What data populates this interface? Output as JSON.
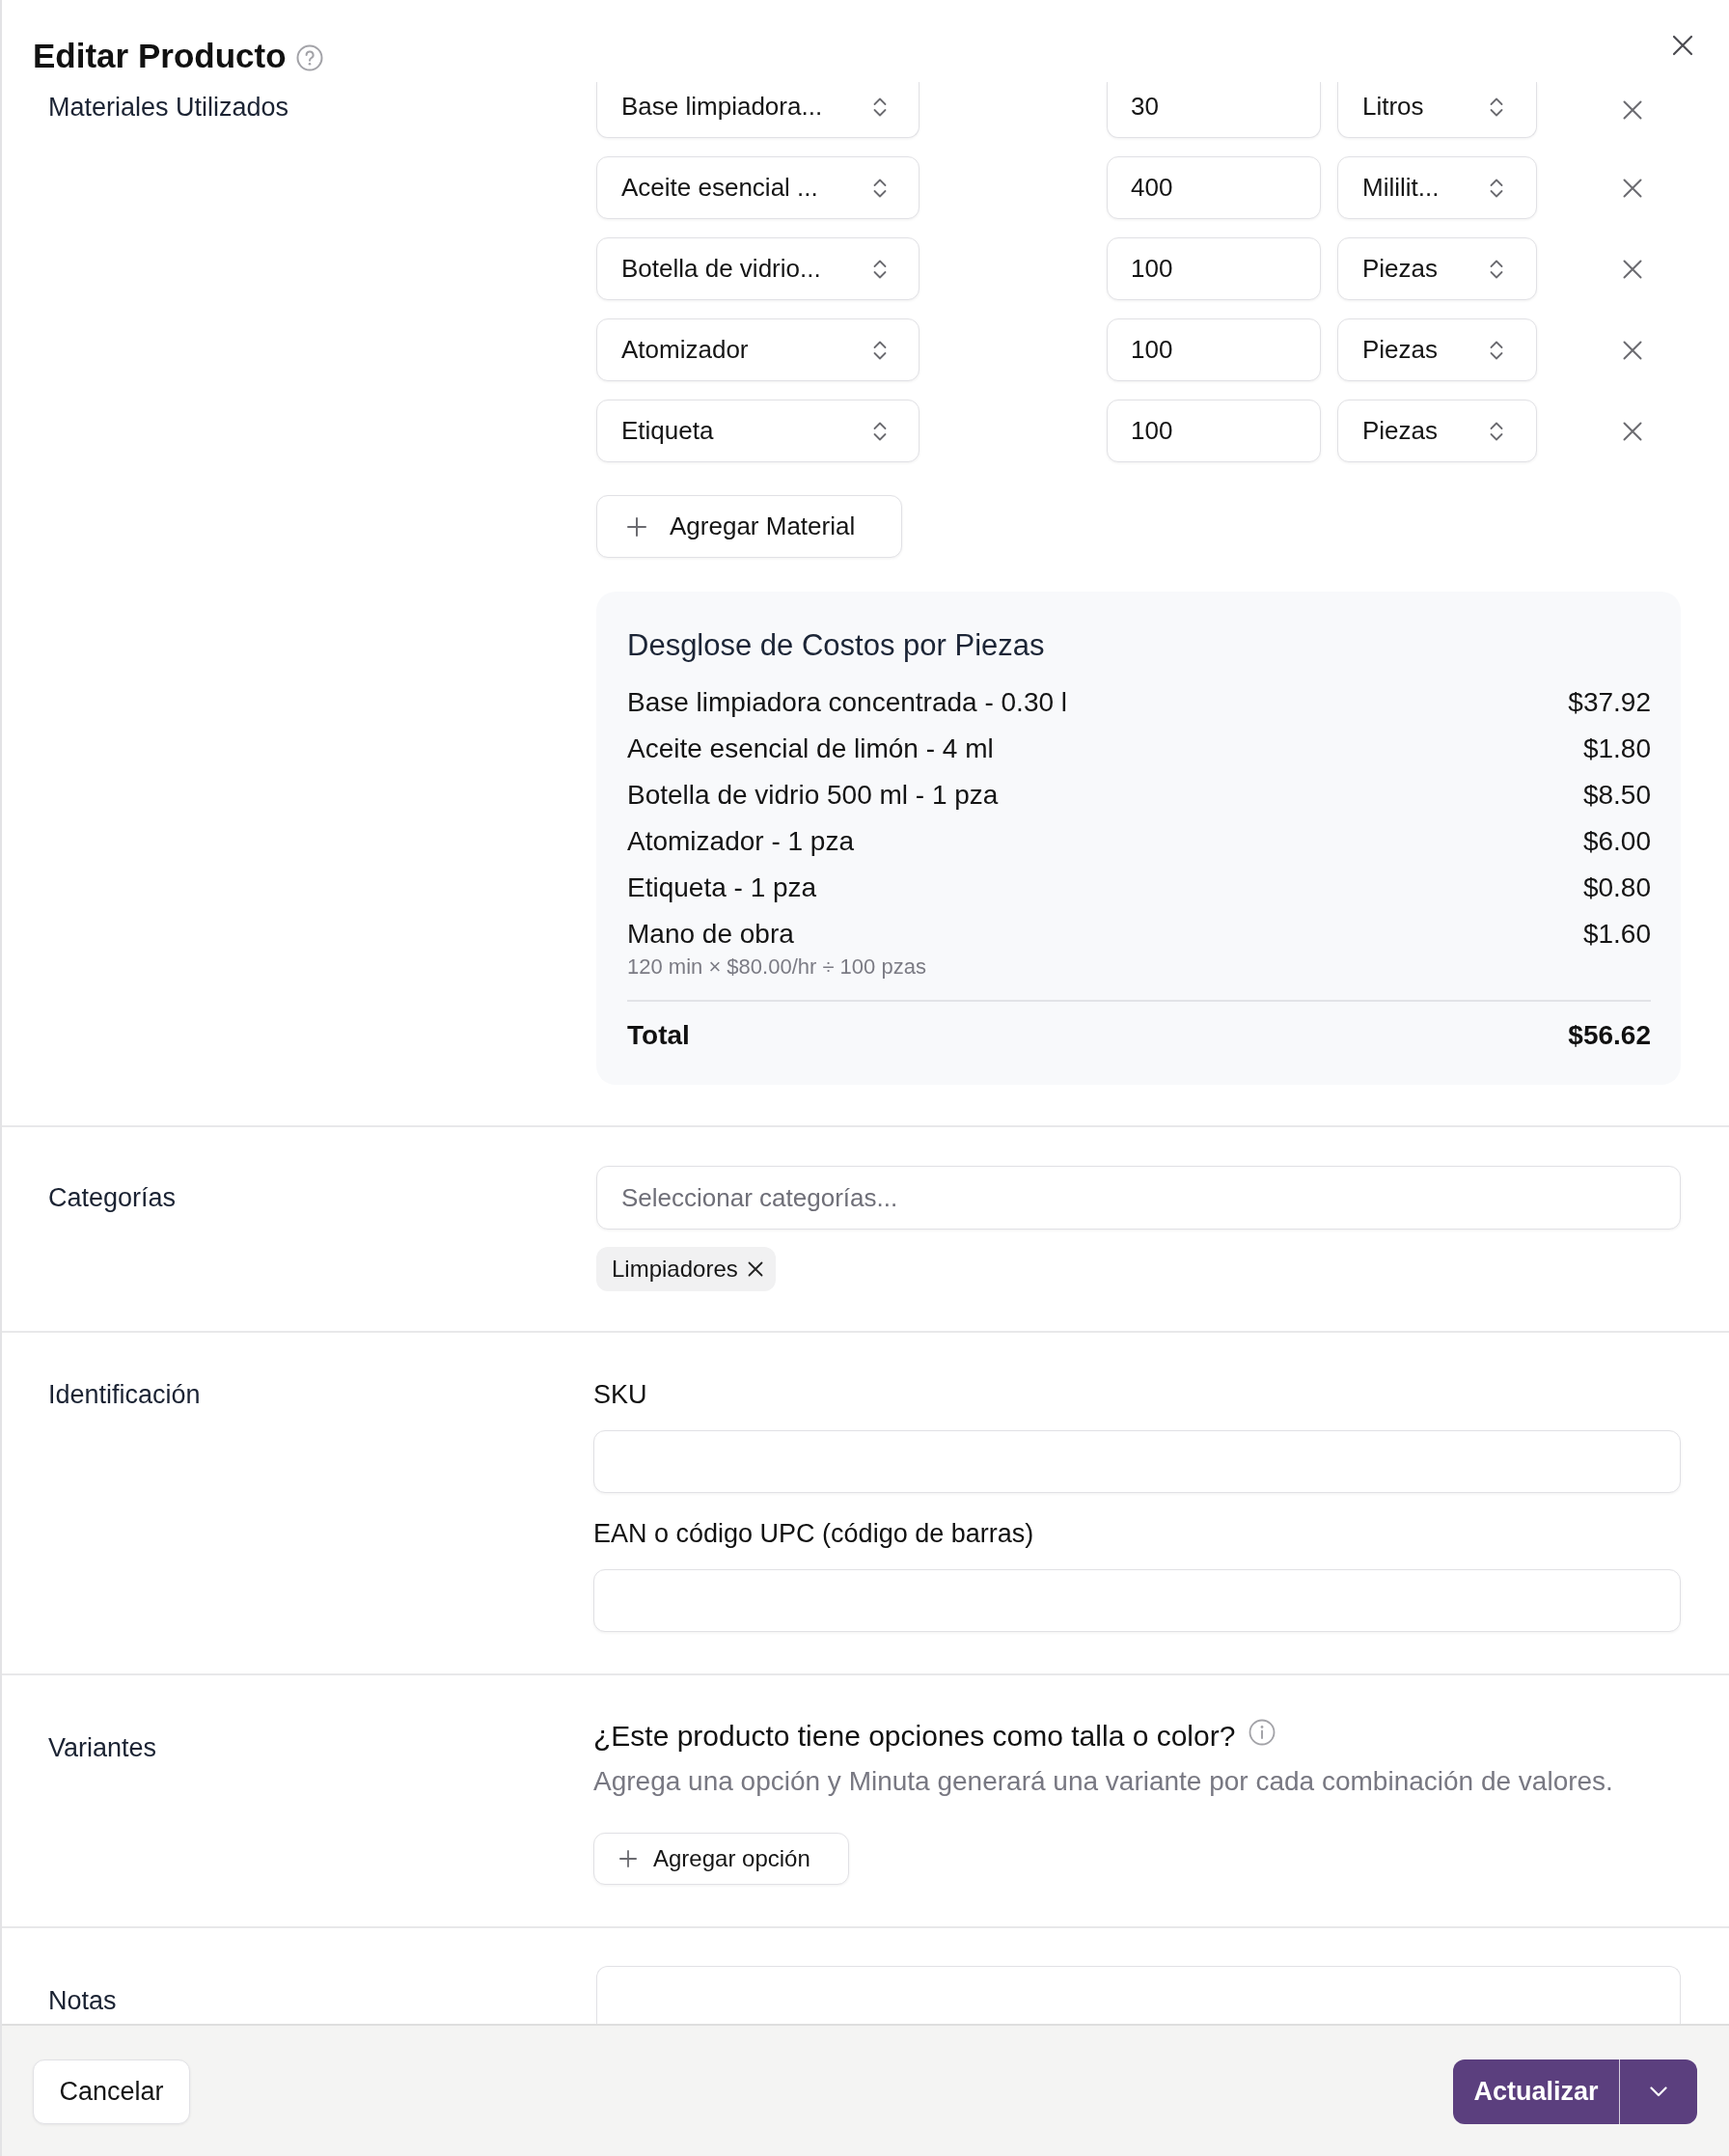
{
  "dialog": {
    "title": "Editar Producto"
  },
  "materials": {
    "label": "Materiales Utilizados",
    "rows": [
      {
        "material": "Base limpiadora...",
        "quantity": "30",
        "unit": "Litros"
      },
      {
        "material": "Aceite esencial ...",
        "quantity": "400",
        "unit": "Mililit..."
      },
      {
        "material": "Botella de vidrio...",
        "quantity": "100",
        "unit": "Piezas"
      },
      {
        "material": "Atomizador",
        "quantity": "100",
        "unit": "Piezas"
      },
      {
        "material": "Etiqueta",
        "quantity": "100",
        "unit": "Piezas"
      }
    ],
    "add_button": "Agregar Material"
  },
  "cost_breakdown": {
    "title": "Desglose de Costos por Piezas",
    "items": [
      {
        "name": "Base limpiadora concentrada - 0.30 l",
        "amount": "$37.92"
      },
      {
        "name": "Aceite esencial de limón - 4 ml",
        "amount": "$1.80"
      },
      {
        "name": "Botella de vidrio 500 ml - 1 pza",
        "amount": "$8.50"
      },
      {
        "name": "Atomizador - 1 pza",
        "amount": "$6.00"
      },
      {
        "name": "Etiqueta - 1 pza",
        "amount": "$0.80"
      },
      {
        "name": "Mano de obra",
        "amount": "$1.60",
        "note": "120 min × $80.00/hr ÷ 100 pzas"
      }
    ],
    "total_label": "Total",
    "total": "$56.62"
  },
  "categories": {
    "label": "Categorías",
    "placeholder": "Seleccionar categorías...",
    "tags": [
      "Limpiadores"
    ]
  },
  "identification": {
    "label": "Identificación",
    "fields": [
      {
        "label": "SKU"
      },
      {
        "label": "EAN o código UPC (código de barras)"
      }
    ]
  },
  "variants": {
    "label": "Variantes",
    "question": "¿Este producto tiene opciones como talla o color?",
    "description": "Agrega una opción y Minuta generará una variante por cada combinación de valores.",
    "add_button": "Agregar opción"
  },
  "notes": {
    "label": "Notas"
  },
  "footer": {
    "cancel": "Cancelar",
    "submit": "Actualizar"
  }
}
